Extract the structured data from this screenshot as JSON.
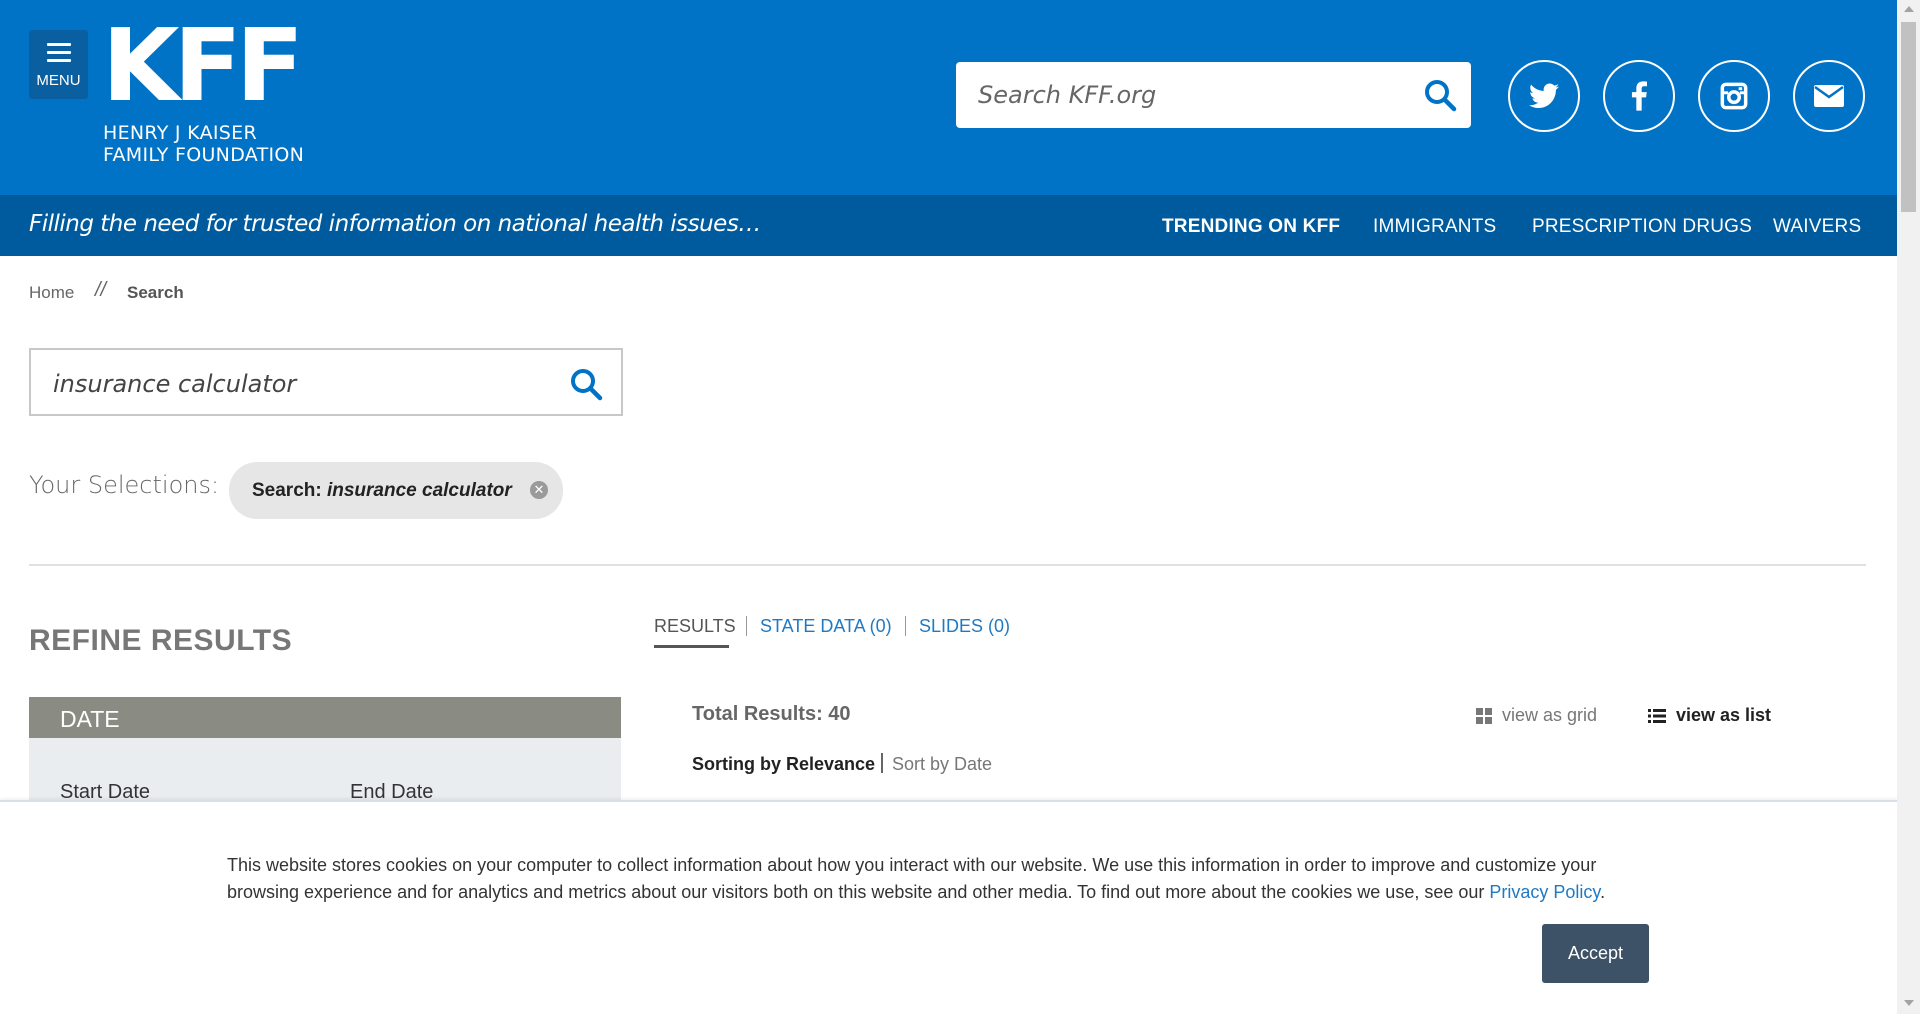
{
  "header": {
    "menu_label": "MENU",
    "logo_letters": "KFF",
    "logo_line1": "HENRY J KAISER",
    "logo_line2": "FAMILY FOUNDATION",
    "search_placeholder": "Search KFF.org",
    "brand_color": "#0073c6",
    "social": [
      "twitter-icon",
      "facebook-icon",
      "instagram-icon",
      "email-icon"
    ]
  },
  "tagline_bar": {
    "tagline": "Filling the need for trusted information on national health issues…",
    "trending_label": "TRENDING ON KFF",
    "trending_links": [
      "IMMIGRANTS",
      "PRESCRIPTION DRUGS",
      "WAIVERS"
    ]
  },
  "breadcrumb": {
    "home": "Home",
    "separator": "//",
    "current": "Search"
  },
  "search": {
    "value": "insurance calculator"
  },
  "selections": {
    "label": "Your Selections:",
    "chip_key": "Search:",
    "chip_value": "insurance calculator"
  },
  "refine": {
    "title": "REFINE RESULTS",
    "date_header": "DATE",
    "start_label": "Start Date",
    "end_label": "End Date"
  },
  "tabs": [
    "RESULTS",
    "STATE DATA (0)",
    "SLIDES (0)"
  ],
  "results": {
    "total": "Total Results: 40",
    "view_grid": "view as grid",
    "view_list": "view as list",
    "sort_active": "Sorting by Relevance",
    "sort_alt": "Sort by Date"
  },
  "cookie": {
    "text": "This website stores cookies on your computer to collect information about how you interact with our website. We use this information in order to improve and customize your browsing experience and for analytics and metrics about our visitors both on this website and other media. To find out more about the cookies we use, see our ",
    "link": "Privacy Policy",
    "end": ".",
    "accept": "Accept",
    "accept_color": "#3d5266"
  }
}
